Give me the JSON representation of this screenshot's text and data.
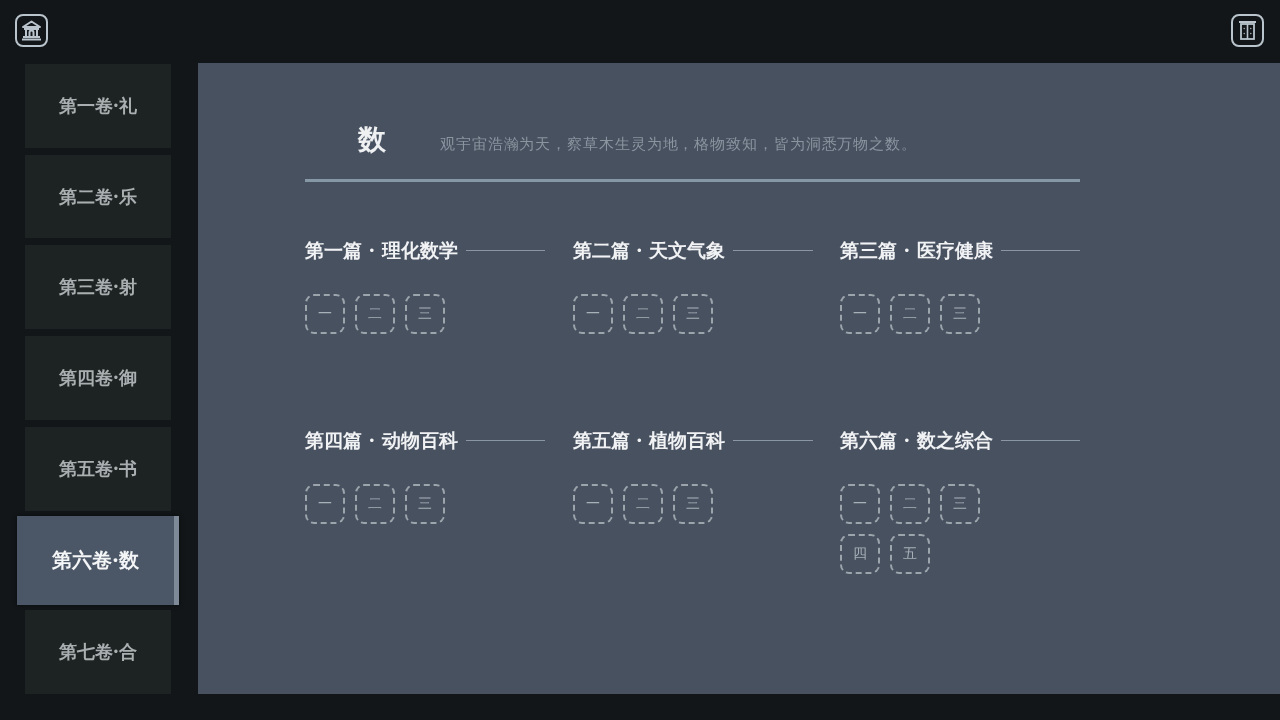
{
  "sidebar": {
    "items": [
      {
        "label": "第一卷·礼",
        "selected": false
      },
      {
        "label": "第二卷·乐",
        "selected": false
      },
      {
        "label": "第三卷·射",
        "selected": false
      },
      {
        "label": "第四卷·御",
        "selected": false
      },
      {
        "label": "第五卷·书",
        "selected": false
      },
      {
        "label": "第六卷·数",
        "selected": true
      },
      {
        "label": "第七卷·合",
        "selected": false
      }
    ]
  },
  "page": {
    "title": "数",
    "description": "观宇宙浩瀚为天，察草木生灵为地，格物致知，皆为洞悉万物之数。"
  },
  "sections": [
    {
      "title": "第一篇 · 理化数学",
      "lessons": [
        "一",
        "二",
        "三"
      ]
    },
    {
      "title": "第二篇 · 天文气象",
      "lessons": [
        "一",
        "二",
        "三"
      ]
    },
    {
      "title": "第三篇 · 医疗健康",
      "lessons": [
        "一",
        "二",
        "三"
      ]
    },
    {
      "title": "第四篇 · 动物百科",
      "lessons": [
        "一",
        "二",
        "三"
      ]
    },
    {
      "title": "第五篇 · 植物百科",
      "lessons": [
        "一",
        "二",
        "三"
      ]
    },
    {
      "title": "第六篇 · 数之综合",
      "lessons": [
        "一",
        "二",
        "三",
        "四",
        "五"
      ]
    }
  ]
}
